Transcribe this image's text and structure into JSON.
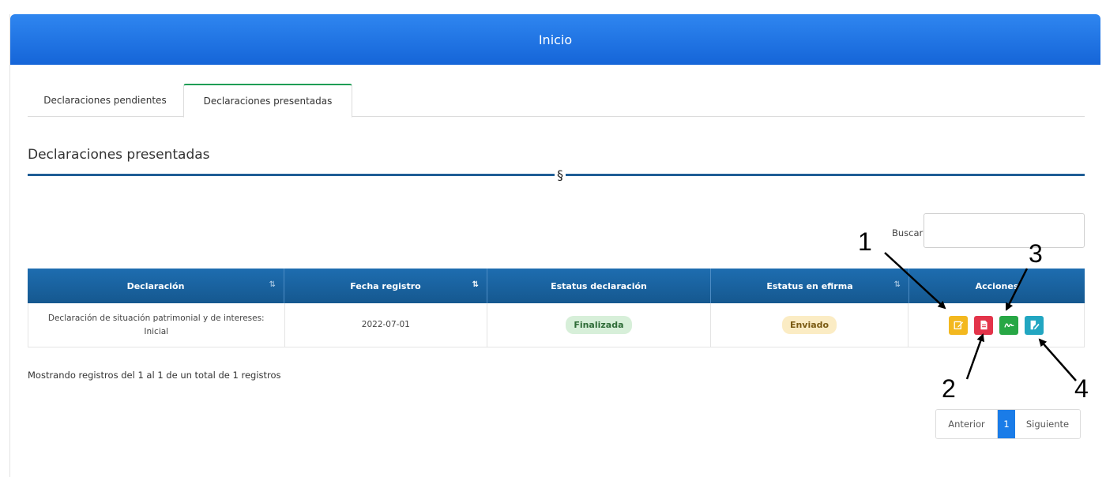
{
  "header": {
    "title": "Inicio"
  },
  "tabs": [
    {
      "label": "Declaraciones pendientes",
      "active": false
    },
    {
      "label": "Declaraciones presentadas",
      "active": true
    }
  ],
  "section": {
    "title": "Declaraciones presentadas",
    "divider_symbol": "§"
  },
  "search": {
    "label": "Buscar:",
    "value": ""
  },
  "table": {
    "columns": [
      "Declaración",
      "Fecha registro",
      "Estatus declaración",
      "Estatus en efirma",
      "Acciones"
    ],
    "rows": [
      {
        "declaracion": "Declaración de situación patrimonial y de intereses: Inicial",
        "fecha": "2022-07-01",
        "estatus_declaracion": "Finalizada",
        "estatus_efirma": "Enviado",
        "actions": [
          "edit-icon",
          "pdf-icon",
          "signature-icon",
          "document-edit-icon"
        ]
      }
    ]
  },
  "info": "Mostrando registros del 1 al 1 de un total de 1 registros",
  "pagination": {
    "prev": "Anterior",
    "current": "1",
    "next": "Siguiente"
  },
  "annotations": [
    "1",
    "2",
    "3",
    "4"
  ],
  "colors": {
    "header": "#1565d8",
    "table_header": "#1e6db0",
    "edit": "#f3b81f",
    "pdf": "#e3344a",
    "sign": "#27a745",
    "doc": "#22a6c1",
    "page_active": "#1a7ce8"
  }
}
